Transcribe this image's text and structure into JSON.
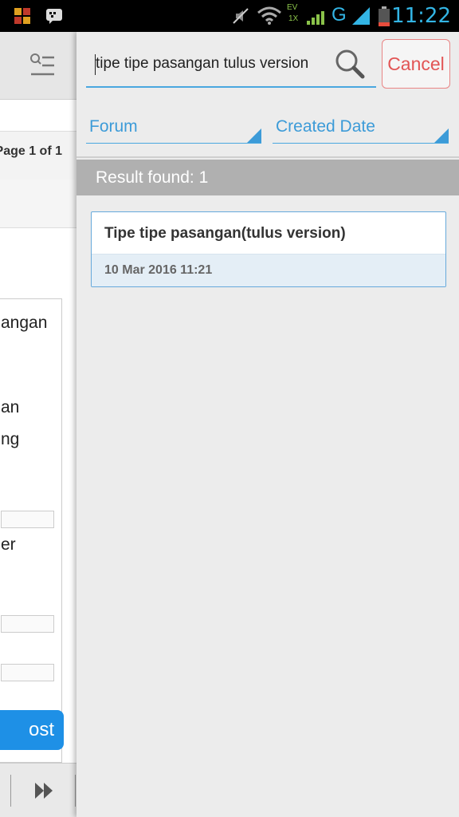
{
  "status_bar": {
    "time": "11:22",
    "network_label": "G",
    "ev_label": "EV",
    "onex_label": "1X",
    "icons": [
      "app-grid-icon",
      "bbm-icon",
      "mute-icon",
      "wifi-icon",
      "signal-icon",
      "battery-icon"
    ]
  },
  "left_panel": {
    "page_info": "Page 1 of 1",
    "fragments": [
      "angan",
      "an",
      "ng",
      "er"
    ],
    "post_button": "ost"
  },
  "search": {
    "value": "tipe tipe pasangan tulus version",
    "cancel_label": "Cancel"
  },
  "filters": {
    "forum_label": "Forum",
    "date_label": "Created Date"
  },
  "results": {
    "summary": "Result found: 1",
    "items": [
      {
        "title": "Tipe tipe pasangan(tulus version)",
        "date": "10 Mar 2016 11:21"
      }
    ]
  },
  "colors": {
    "accent": "#3c9bd8",
    "cancel": "#e25555",
    "result_bar": "#b0b0b0",
    "post_button": "#1e90e6"
  }
}
